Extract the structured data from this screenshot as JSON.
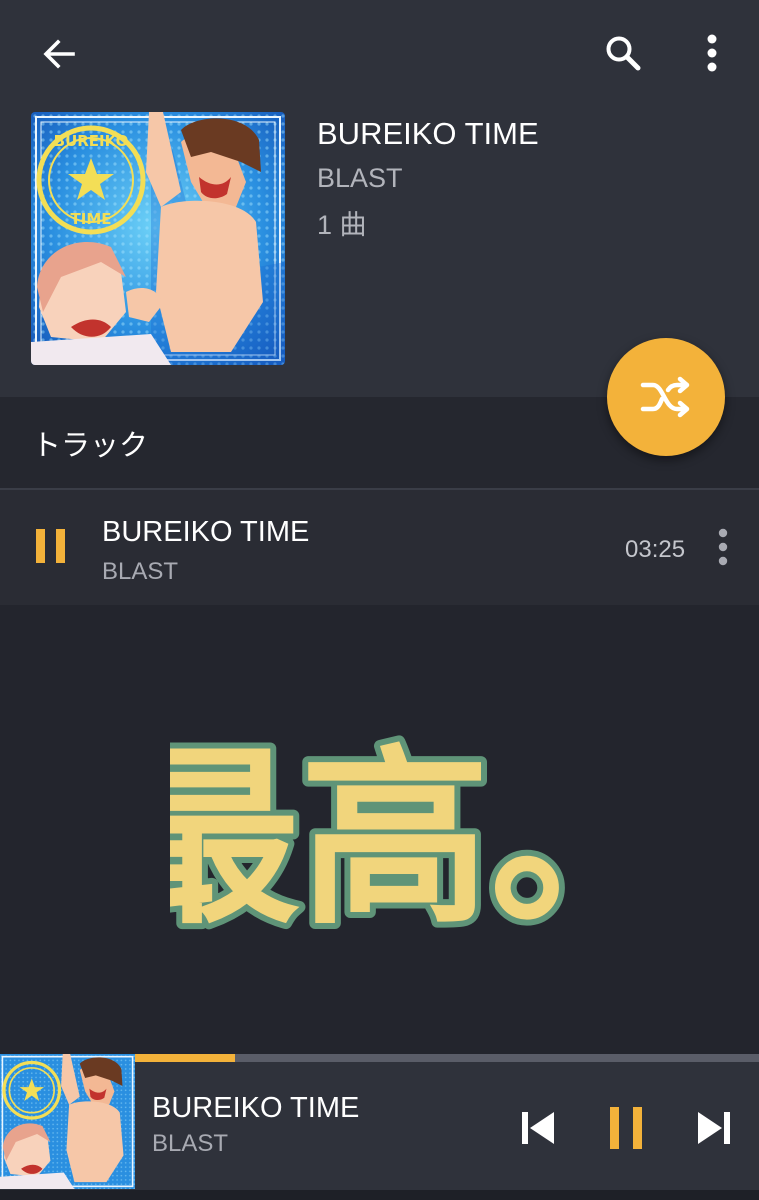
{
  "colors": {
    "accent": "#f3b23a",
    "header_bg": "#2f323b",
    "list_bg": "#23252d",
    "sticker_fill": "#f1d57c",
    "sticker_outline": "#5f9478"
  },
  "toolbar": {
    "back_icon": "arrow-back-icon",
    "search_icon": "search-icon",
    "menu_icon": "more-vert-icon"
  },
  "album": {
    "title": "BUREIKO TIME",
    "artist": "BLAST",
    "count": "1 曲",
    "badge_text": "BUREIKO TIME"
  },
  "shuffle": {
    "icon": "shuffle-icon"
  },
  "tracks": {
    "header": "トラック",
    "items": [
      {
        "title": "BUREIKO TIME",
        "artist": "BLAST",
        "duration": "03:25",
        "state": "playing"
      }
    ]
  },
  "sticker": {
    "text": "最高。"
  },
  "player": {
    "title": "BUREIKO TIME",
    "artist": "BLAST",
    "progress": 0.31,
    "prev_icon": "skip-previous-icon",
    "pause_icon": "pause-icon",
    "next_icon": "skip-next-icon"
  }
}
